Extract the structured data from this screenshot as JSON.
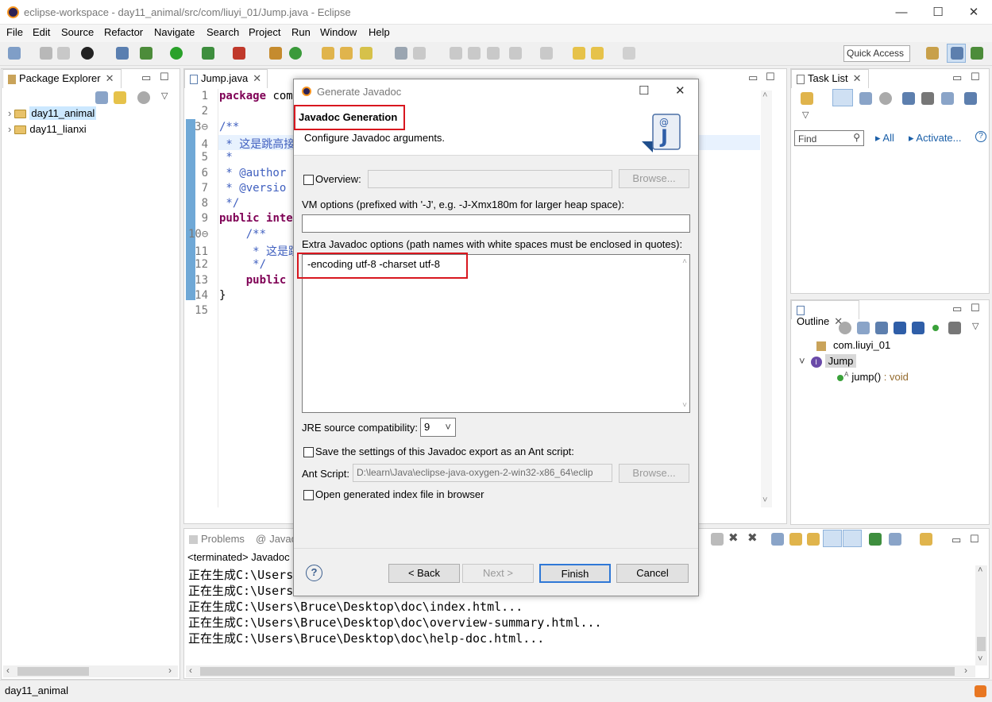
{
  "window": {
    "title": "eclipse-workspace - day11_animal/src/com/liuyi_01/Jump.java - Eclipse",
    "min": "—",
    "max": "☐",
    "close": "✕"
  },
  "menu": [
    "File",
    "Edit",
    "Source",
    "Refactor",
    "Navigate",
    "Search",
    "Project",
    "Run",
    "Window",
    "Help"
  ],
  "quick_access": "Quick Access",
  "package_explorer": {
    "tab": "Package Explorer",
    "projects": [
      "day11_animal",
      "day11_lianxi"
    ]
  },
  "editor": {
    "tab": "Jump.java",
    "lines": [
      {
        "n": "1",
        "parts": [
          [
            "kw",
            "package "
          ],
          [
            "",
            "com"
          ]
        ]
      },
      {
        "n": "2",
        "parts": []
      },
      {
        "n": "3⊖",
        "parts": [
          [
            "cm",
            "/**"
          ]
        ]
      },
      {
        "n": "4",
        "parts": [
          [
            "cm",
            " * 这是跳高接口"
          ]
        ]
      },
      {
        "n": "5",
        "parts": [
          [
            "cm",
            " *"
          ]
        ]
      },
      {
        "n": "6",
        "parts": [
          [
            "cm",
            " * @author"
          ]
        ]
      },
      {
        "n": "7",
        "parts": [
          [
            "cm",
            " * @versio"
          ]
        ]
      },
      {
        "n": "8",
        "parts": [
          [
            "cm",
            " */"
          ]
        ]
      },
      {
        "n": "9",
        "parts": [
          [
            "kw",
            "public "
          ],
          [
            "kw",
            "inte"
          ]
        ]
      },
      {
        "n": "10⊖",
        "parts": [
          [
            "cm",
            "    /**"
          ]
        ]
      },
      {
        "n": "11",
        "parts": [
          [
            "cm",
            "     * 这是跳"
          ]
        ]
      },
      {
        "n": "12",
        "parts": [
          [
            "cm",
            "     */"
          ]
        ]
      },
      {
        "n": "13",
        "parts": [
          [
            "kw",
            "    public"
          ]
        ]
      },
      {
        "n": "14",
        "parts": [
          [
            "",
            "}"
          ]
        ]
      },
      {
        "n": "15",
        "parts": []
      }
    ]
  },
  "task_list": {
    "tab": "Task List",
    "find": "Find",
    "all": "All",
    "activate": "Activate..."
  },
  "outline": {
    "tab": "Outline",
    "package": "com.liuyi_01",
    "type": "Jump",
    "method": "jump()",
    "method_type": " : void"
  },
  "console": {
    "tabs": [
      "Problems",
      "Javado"
    ],
    "terminated": "<terminated> Javadoc",
    "lines": [
      "正在生成C:\\Users",
      "正在生成C:\\Users",
      "正在生成C:\\Users\\Bruce\\Desktop\\doc\\index.html...",
      "正在生成C:\\Users\\Bruce\\Desktop\\doc\\overview-summary.html...",
      "正在生成C:\\Users\\Bruce\\Desktop\\doc\\help-doc.html..."
    ]
  },
  "status": "day11_animal",
  "dialog": {
    "title": "Generate Javadoc",
    "heading": "Javadoc Generation",
    "subheading": "Configure Javadoc arguments.",
    "overview_label": "Overview:",
    "browse": "Browse...",
    "vm_label": "VM options (prefixed with '-J', e.g. -J-Xmx180m for larger heap space):",
    "vm_value": "",
    "extra_label": "Extra Javadoc options (path names with white spaces must be enclosed in quotes):",
    "extra_value": "-encoding utf-8 -charset utf-8",
    "jre_label": "JRE source compatibility:",
    "jre_value": "9",
    "save_ant_label": "Save the settings of this Javadoc export as an Ant script:",
    "ant_label": "Ant Script:",
    "ant_value": "D:\\learn\\Java\\eclipse-java-oxygen-2-win32-x86_64\\eclip",
    "open_index_label": "Open generated index file in browser",
    "help": "?",
    "back": "< Back",
    "next": "Next >",
    "finish": "Finish",
    "cancel": "Cancel"
  }
}
